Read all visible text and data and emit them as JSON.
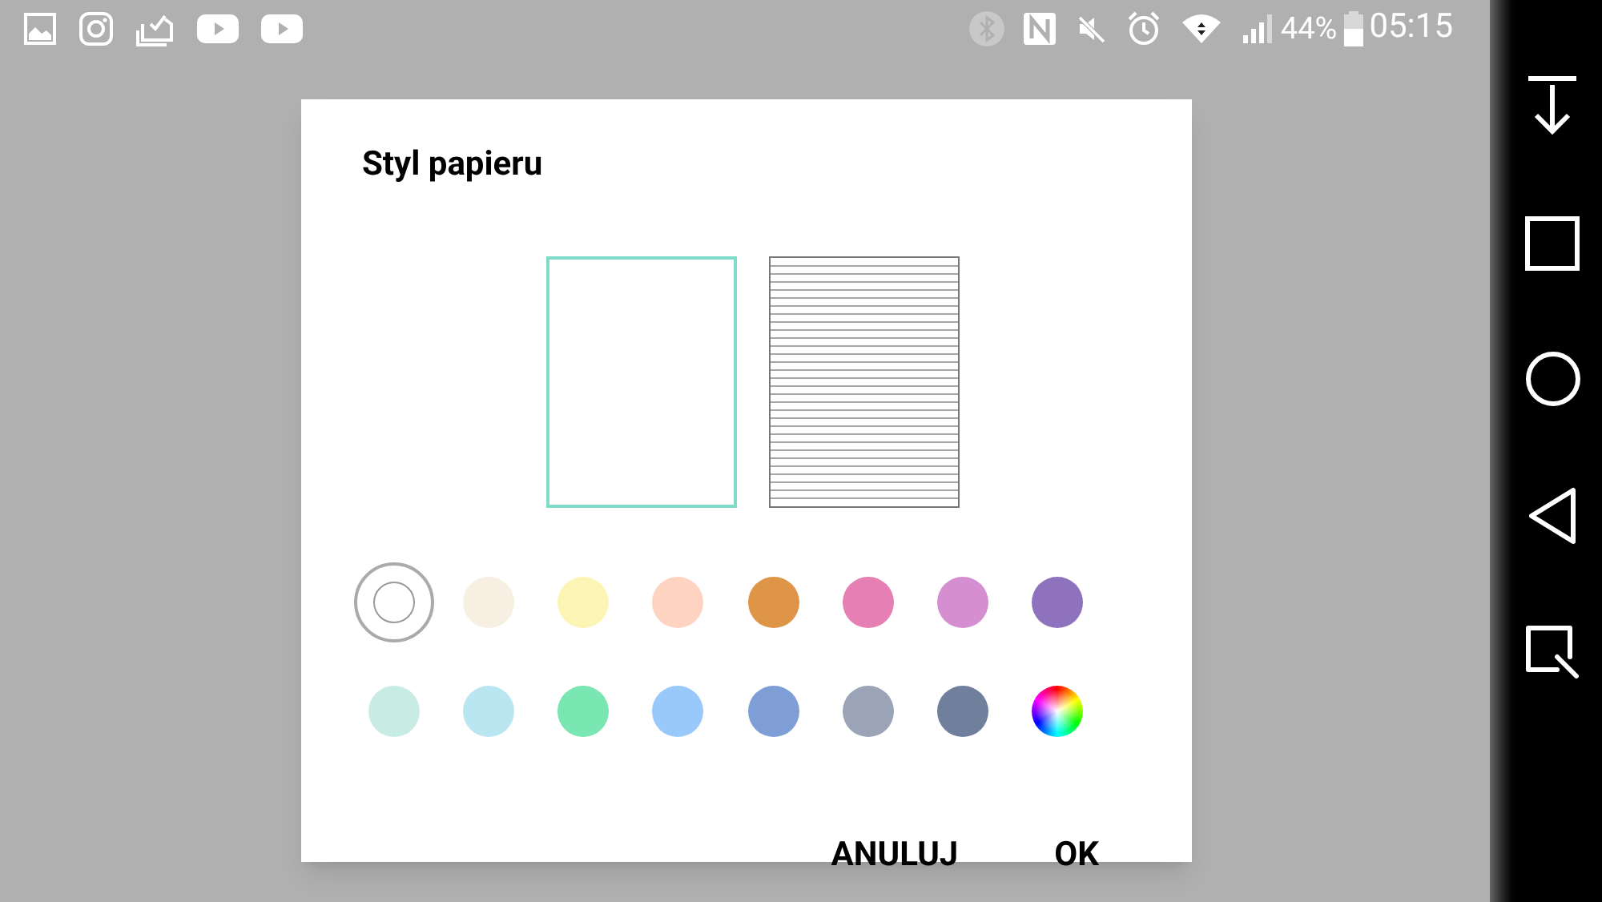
{
  "status_bar": {
    "battery_percent": "44%",
    "time": "05:15"
  },
  "dialog": {
    "title": "Styl papieru",
    "papers": [
      {
        "kind": "plain",
        "selected": true
      },
      {
        "kind": "lined",
        "selected": false
      }
    ],
    "swatches": [
      {
        "kind": "none",
        "selected": true
      },
      {
        "kind": "color",
        "color": "#f6efe2",
        "selected": false
      },
      {
        "kind": "color",
        "color": "#fcf5b5",
        "selected": false
      },
      {
        "kind": "color",
        "color": "#ffd3c2",
        "selected": false
      },
      {
        "kind": "color",
        "color": "#df9548",
        "selected": false
      },
      {
        "kind": "color",
        "color": "#e67fb3",
        "selected": false
      },
      {
        "kind": "color",
        "color": "#d58fd0",
        "selected": false
      },
      {
        "kind": "color",
        "color": "#8e72be",
        "selected": false
      },
      {
        "kind": "color",
        "color": "#c8ece4",
        "selected": false
      },
      {
        "kind": "color",
        "color": "#bae6f2",
        "selected": false
      },
      {
        "kind": "color",
        "color": "#7ae6b2",
        "selected": false
      },
      {
        "kind": "color",
        "color": "#99c9fb",
        "selected": false
      },
      {
        "kind": "color",
        "color": "#7f9ed6",
        "selected": false
      },
      {
        "kind": "color",
        "color": "#9ba3b6",
        "selected": false
      },
      {
        "kind": "color",
        "color": "#6f7f9c",
        "selected": false
      },
      {
        "kind": "spectrum",
        "selected": false
      }
    ],
    "buttons": [
      "ANULUJ",
      "OK"
    ]
  }
}
